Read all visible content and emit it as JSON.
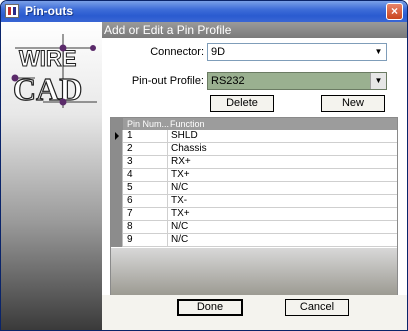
{
  "window": {
    "title": "Pin-outs",
    "close_glyph": "×"
  },
  "logo": {
    "line1": "WIRE",
    "line2": "CAD"
  },
  "header": {
    "title": "Add or Edit a Pin Profile"
  },
  "form": {
    "connector_label": "Connector:",
    "connector_value": "9D",
    "profile_label": "Pin-out Profile:",
    "profile_value": "RS232",
    "arrow_glyph": "▼"
  },
  "buttons": {
    "delete": "Delete",
    "new": "New",
    "done": "Done",
    "cancel": "Cancel"
  },
  "grid": {
    "columns": [
      "Pin Num...",
      "Function"
    ],
    "rows": [
      {
        "pin": "1",
        "function": "SHLD"
      },
      {
        "pin": "2",
        "function": "Chassis"
      },
      {
        "pin": "3",
        "function": "RX+"
      },
      {
        "pin": "4",
        "function": "TX+"
      },
      {
        "pin": "5",
        "function": "N/C"
      },
      {
        "pin": "6",
        "function": "TX-"
      },
      {
        "pin": "7",
        "function": "TX+"
      },
      {
        "pin": "8",
        "function": "N/C"
      },
      {
        "pin": "9",
        "function": "N/C"
      }
    ],
    "selected_index": 0
  },
  "colors": {
    "title_bar": "#2a5bd0",
    "profile_combo": "#9ab090",
    "header_bar": "#8a8a8a"
  },
  "icons": {
    "app": "app-icon",
    "close": "close-icon",
    "dropdown": "chevron-down-icon",
    "row_pointer": "row-pointer-icon"
  }
}
